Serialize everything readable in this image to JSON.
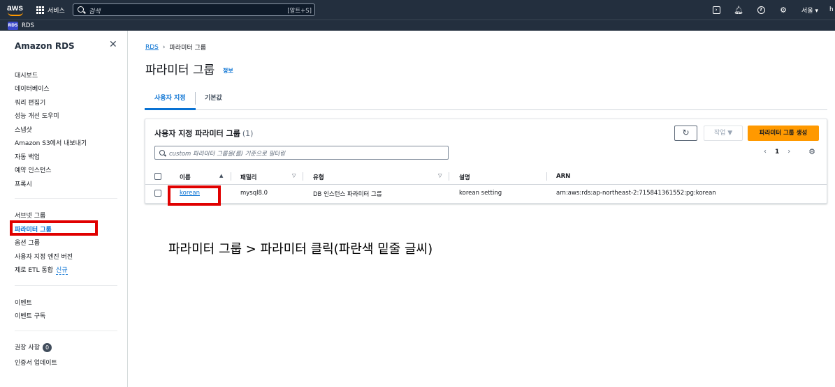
{
  "topnav": {
    "logo": "aws",
    "services_label": "서비스",
    "search_placeholder": "검색",
    "search_shortcut": "[알트+S]",
    "region": "서울 ▾",
    "account": "h"
  },
  "servicebar": {
    "service_icon": "RDS",
    "service_label": "RDS"
  },
  "sidebar": {
    "title": "Amazon RDS",
    "group1": [
      "대시보드",
      "데이터베이스",
      "쿼리 편집기",
      "성능 개선 도우미",
      "스냅샷",
      "Amazon S3에서 내보내기",
      "자동 백업",
      "예약 인스턴스",
      "프록시"
    ],
    "group2": [
      "서브넷 그룹",
      "파라미터 그룹",
      "옵션 그룹",
      "사용자 지정 엔진 버전"
    ],
    "zero_etl": "제로 ETL 통합",
    "new_badge": "신규",
    "group3": [
      "이벤트",
      "이벤트 구독"
    ],
    "recommendations": "권장 사항",
    "recommendations_count": "0",
    "cert_update": "인증서 업데이트"
  },
  "breadcrumb": {
    "root": "RDS",
    "separator": "›",
    "current": "파라미터 그룹"
  },
  "page": {
    "title": "파라미터 그룹",
    "info": "정보"
  },
  "tabs": [
    {
      "label": "사용자 지정"
    },
    {
      "label": "기본값"
    }
  ],
  "panel": {
    "title": "사용자 지정 파라미터 그룹",
    "count": "(1)",
    "action_label": "작업 ▼",
    "create_label": "파라미터 그룹 생성",
    "filter_placeholder": "custom 파라미터 그룹을(를) 기준으로 필터링",
    "page": "1",
    "prev": "‹",
    "next": "›"
  },
  "table": {
    "columns": [
      "이름",
      "패밀리",
      "유형",
      "설명",
      "ARN"
    ],
    "rows": [
      {
        "name": "korean",
        "family": "mysql8.0",
        "type": "DB 인스턴스 파라미터 그룹",
        "description": "korean setting",
        "arn": "arn:aws:rds:ap-northeast-2:715841361552:pg:korean"
      }
    ]
  },
  "annotation": "파라미터 그룹 > 파라미터 클릭(파란색 밑줄 글씨)",
  "colors": {
    "nav_bg": "#232f3e",
    "link_blue": "#0972d3",
    "primary_orange": "#ff9900",
    "highlight_red": "#e00000"
  }
}
